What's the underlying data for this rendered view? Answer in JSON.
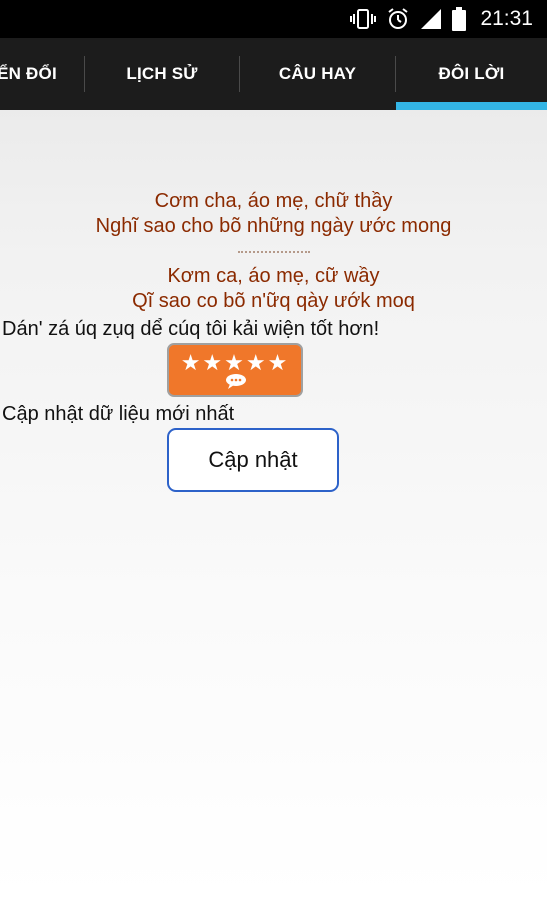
{
  "status_bar": {
    "time": "21:31",
    "icons": [
      "vibrate-icon",
      "alarm-icon",
      "signal-icon",
      "battery-icon"
    ]
  },
  "tabs": [
    {
      "label": "ỂN ĐỔI"
    },
    {
      "label": "LỊCH SỬ"
    },
    {
      "label": "CÂU HAY"
    },
    {
      "label": "ĐÔI LỜI",
      "selected": true
    }
  ],
  "content": {
    "poem_line_1": "Cơm cha, áo mẹ, chữ thầy",
    "poem_line_2": "Nghĩ sao cho bõ những ngày ước mong",
    "converted_line_1": "Kơm ca, áo mẹ, cữ wầy",
    "converted_line_2": "Qĩ sao co bõ n'ữq qày ướk moq",
    "rate_prompt": "Dán' zá úq zụq dể cúq tôi kải wiện tốt hơn!",
    "rate_stars": "★★★★★",
    "update_prompt": "Cập nhật dữ liệu mới nhất",
    "update_button": "Cập nhật"
  },
  "colors": {
    "accent": "#33b5e5",
    "poem_text": "#8b2a00",
    "rate_button": "#f0772a",
    "update_border": "#2d62c9"
  }
}
